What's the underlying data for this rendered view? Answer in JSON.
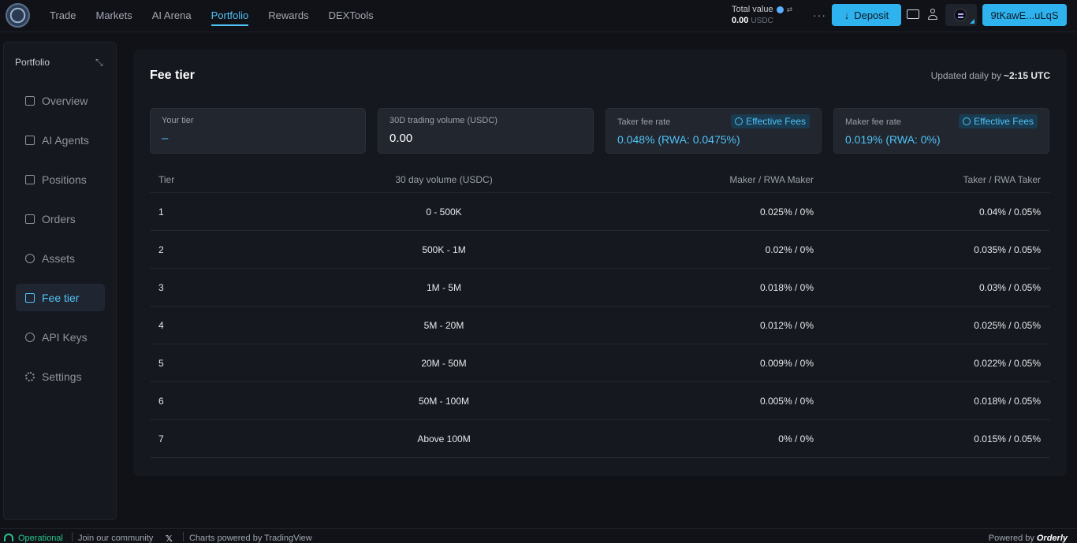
{
  "header": {
    "nav": [
      "Trade",
      "Markets",
      "AI Arena",
      "Portfolio",
      "Rewards",
      "DEXTools"
    ],
    "active_nav": "Portfolio",
    "total_value_label": "Total value",
    "total_value": "0.00",
    "total_value_unit": "USDC",
    "deposit_label": "Deposit",
    "wallet_label": "9tKawE...uLqS"
  },
  "sidebar": {
    "title": "Portfolio",
    "items": [
      {
        "label": "Overview",
        "icon": "overview-icon"
      },
      {
        "label": "AI Agents",
        "icon": "robot-icon"
      },
      {
        "label": "Positions",
        "icon": "positions-icon"
      },
      {
        "label": "Orders",
        "icon": "orders-icon"
      },
      {
        "label": "Assets",
        "icon": "dollar-icon"
      },
      {
        "label": "Fee tier",
        "icon": "calculator-icon",
        "active": true
      },
      {
        "label": "API Keys",
        "icon": "api-key-icon"
      },
      {
        "label": "Settings",
        "icon": "gear-icon"
      }
    ]
  },
  "main": {
    "title": "Fee tier",
    "updated_prefix": "Updated daily by",
    "updated_time": "~2:15 UTC",
    "cards": {
      "your_tier_label": "Your tier",
      "your_tier_value": "–",
      "volume_label": "30D trading volume (USDC)",
      "volume_value": "0.00",
      "taker_label": "Taker fee rate",
      "taker_value": "0.048% (RWA: 0.0475%)",
      "maker_label": "Maker fee rate",
      "maker_value": "0.019% (RWA: 0%)",
      "effective_label": "Effective Fees"
    },
    "table": {
      "headers": [
        "Tier",
        "30 day volume (USDC)",
        "Maker / RWA Maker",
        "Taker / RWA Taker"
      ],
      "rows": [
        [
          "1",
          "0 - 500K",
          "0.025% / 0%",
          "0.04% / 0.05%"
        ],
        [
          "2",
          "500K - 1M",
          "0.02% / 0%",
          "0.035% / 0.05%"
        ],
        [
          "3",
          "1M - 5M",
          "0.018% / 0%",
          "0.03% / 0.05%"
        ],
        [
          "4",
          "5M - 20M",
          "0.012% / 0%",
          "0.025% / 0.05%"
        ],
        [
          "5",
          "20M - 50M",
          "0.009% / 0%",
          "0.022% / 0.05%"
        ],
        [
          "6",
          "50M - 100M",
          "0.005% / 0%",
          "0.018% / 0.05%"
        ],
        [
          "7",
          "Above 100M",
          "0% / 0%",
          "0.015% / 0.05%"
        ]
      ]
    }
  },
  "footer": {
    "status": "Operational",
    "community": "Join our community",
    "charts": "Charts powered by TradingView",
    "powered_by": "Powered by",
    "brand": "Orderly"
  },
  "colors": {
    "accent": "#2fb3ee",
    "background": "#101217",
    "panel": "#15181e",
    "status_green": "#27c48a"
  }
}
